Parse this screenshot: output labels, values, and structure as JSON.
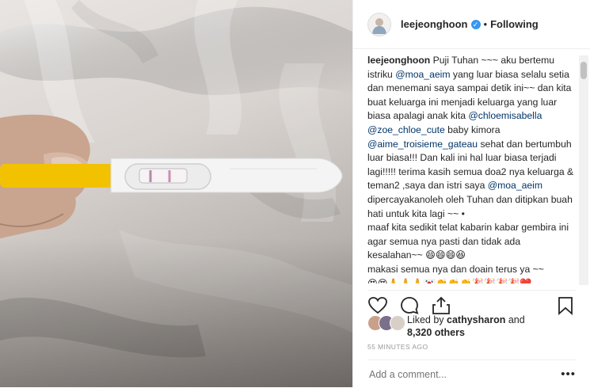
{
  "post": {
    "username": "leejeonghoon",
    "verified_icon": "verified-badge-icon",
    "separator": "•",
    "follow_state": "Following"
  },
  "caption": {
    "username": "leejeonghoon",
    "segments": [
      {
        "t": " Puji Tuhan ~~~ aku bertemu istriku ",
        "m": false
      },
      {
        "t": "@moa_aeim",
        "m": true
      },
      {
        "t": " yang luar biasa selalu setia dan menemani saya sampai detik ini~~ dan kita buat keluarga ini menjadi keluarga yang luar biasa apalagi anak kita ",
        "m": false
      },
      {
        "t": "@chloemisabella",
        "m": true
      },
      {
        "t": " ",
        "m": false
      },
      {
        "t": "@zoe_chloe_cute",
        "m": true
      },
      {
        "t": " baby kimora ",
        "m": false
      },
      {
        "t": "@aime_troisieme_gateau",
        "m": true
      },
      {
        "t": " sehat dan bertumbuh luar biasa!!! Dan kali ini hal luar biasa terjadi lagi!!!!! terima kasih semua doa2 nya keluarga & teman2 ,saya dan istri saya ",
        "m": false
      },
      {
        "t": "@moa_aeim",
        "m": true
      },
      {
        "t": " dipercayakanoleh oleh Tuhan dan ditipkan buah hati untuk kita lagi ~~ •",
        "m": false
      },
      {
        "t": "\nmaaf kita sedikit telat kabarin kabar gembira ini agar semua nya pasti dan tidak ada kesalahan~~ 😄😄😄😆",
        "m": false
      },
      {
        "t": "\nmakasi semua nya dan doain terus ya ~~",
        "m": false
      },
      {
        "t": "\n😍😍🙏🙏🙏🇰🇷👏👏👏🎉🎉🎉🎉❤️",
        "m": false
      },
      {
        "t": "\n❤️",
        "m": false
      }
    ]
  },
  "actions": {
    "like_icon": "heart-icon",
    "comment_icon": "comment-icon",
    "share_icon": "share-icon",
    "save_icon": "bookmark-icon"
  },
  "likes": {
    "prefix": "Liked by ",
    "user": "cathysharon",
    "middle": " and",
    "count": "8,320 others"
  },
  "timestamp": "55 MINUTES AGO",
  "comment": {
    "placeholder": "Add a comment...",
    "more": "•••"
  },
  "colors": {
    "mention": "#003569",
    "verified": "#3897f0",
    "test_handle": "#f2c200",
    "test_body": "#f4f4f4"
  }
}
